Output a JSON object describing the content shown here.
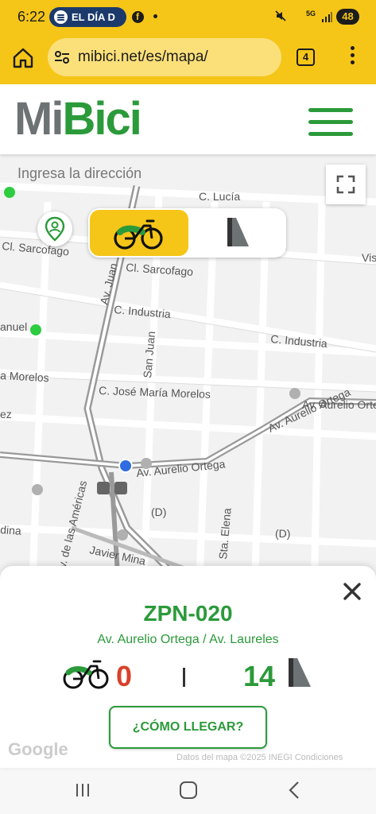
{
  "status_bar": {
    "time": "6:22",
    "news_pill_text": "EL DÍA D",
    "network": "5G",
    "battery": "48"
  },
  "browser": {
    "url": "mibici.net/es/mapa/",
    "tab_count": "4"
  },
  "header": {
    "logo_mi": "Mi",
    "logo_bici": "Bici"
  },
  "map": {
    "search_placeholder": "Ingresa la dirección",
    "street_labels": [
      "C. Lucía",
      "Cl. Sarcofago",
      "Cl. Sarcofago",
      "Vis",
      "Av. Juan",
      "C. Industria",
      "C. Industria",
      "anuel",
      "San Juan",
      "a Morelos",
      "C. José María Morelos",
      "Av. Aurelio Ortega",
      "Av. Aurelio Ortega",
      "ez",
      "Av. Aurelio Ortega",
      "(D)",
      "(D)",
      "dina",
      "Av. de las Américas",
      "Javier Mina",
      "Sta. Elena"
    ],
    "toggle": {
      "selected": "bikes"
    }
  },
  "station": {
    "code": "ZPN-020",
    "address": "Av. Aurelio Ortega / Av. Laureles",
    "bikes_available": "0",
    "docks_available": "14",
    "separator": "|",
    "route_button": "¿CÓMO LLEGAR?",
    "attribution": "Datos del mapa ©2025 INEGI   Condiciones",
    "google": "Google"
  },
  "colors": {
    "brand_yellow": "#f5c518",
    "brand_green": "#2b9a3a",
    "unavailable_red": "#d9412b",
    "logo_gray": "#6d7275"
  }
}
